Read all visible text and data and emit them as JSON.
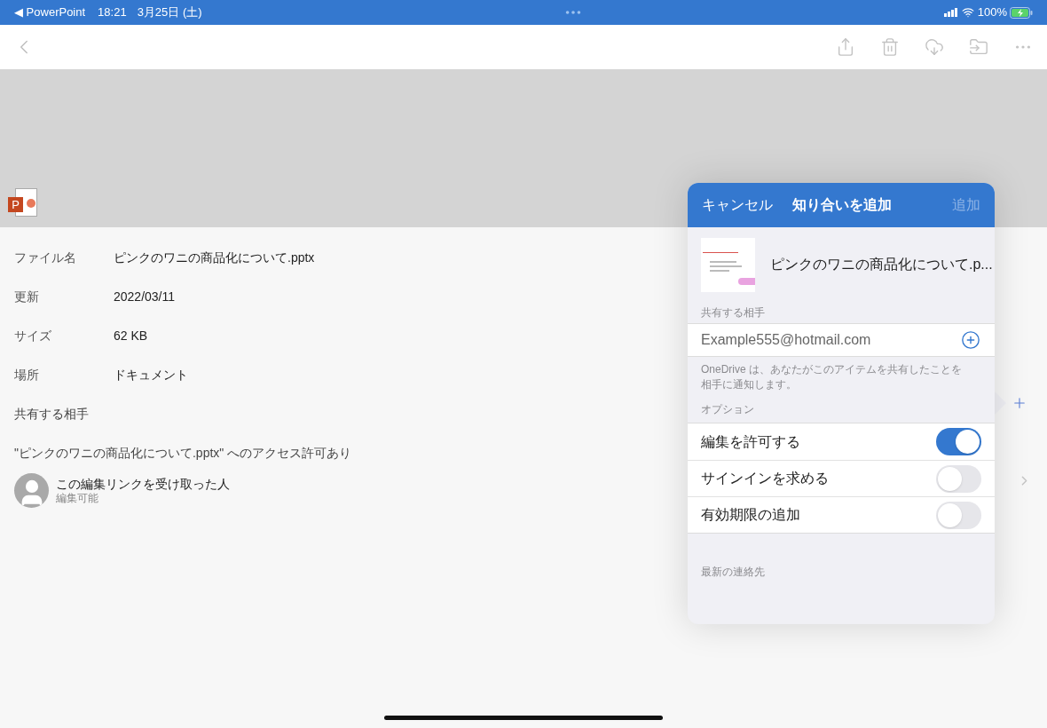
{
  "status_bar": {
    "back_app": "◀ PowerPoint",
    "time": "18:21",
    "date": "3月25日 (土)",
    "battery": "100%"
  },
  "file_icon_letter": "P",
  "details": [
    {
      "label": "ファイル名",
      "value": "ピンクのワニの商品化について.pptx"
    },
    {
      "label": "更新",
      "value": "2022/03/11"
    },
    {
      "label": "サイズ",
      "value": "62 KB"
    },
    {
      "label": "場所",
      "value": "ドキュメント"
    }
  ],
  "shared_with_label": "共有する相手",
  "access_heading": "\"ピンクのワニの商品化について.pptx\" へのアクセス許可あり",
  "access_entries": [
    {
      "name": "この編集リンクを受け取った人",
      "permission": "編集可能"
    }
  ],
  "popover": {
    "cancel": "キャンセル",
    "title": "知り合いを追加",
    "add": "追加",
    "add_disabled": true,
    "file_name": "ピンクのワニの商品化について.p...",
    "recipients_label": "共有する相手",
    "email": {
      "value": "Example555@hotmail.com"
    },
    "notice": "OneDrive は、あなたがこのアイテムを共有したことを相手に通知します。",
    "options_label": "オプション",
    "options": [
      {
        "label": "編集を許可する",
        "on": true
      },
      {
        "label": "サインインを求める",
        "on": false
      },
      {
        "label": "有効期限の追加",
        "on": false
      }
    ],
    "recent_label": "最新の連絡先"
  }
}
